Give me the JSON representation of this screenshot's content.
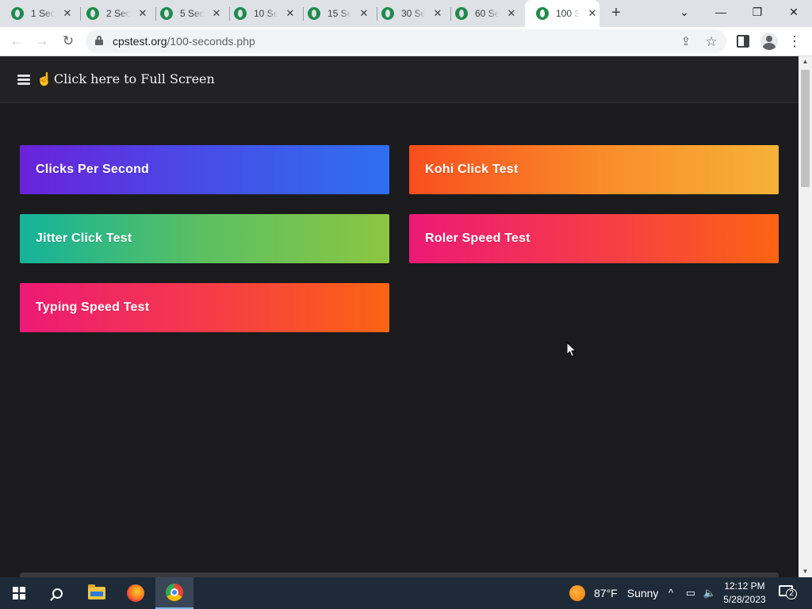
{
  "browser": {
    "tabs": [
      {
        "label": "1 Sec",
        "active": false
      },
      {
        "label": "2 Sec",
        "active": false
      },
      {
        "label": "5 Sec",
        "active": false
      },
      {
        "label": "10 Se",
        "active": false
      },
      {
        "label": "15 Se",
        "active": false
      },
      {
        "label": "30 Se",
        "active": false
      },
      {
        "label": "60 Se",
        "active": false
      },
      {
        "label": "100 S",
        "active": true
      }
    ],
    "tab_close_glyph": "✕",
    "new_tab_glyph": "+",
    "tab_search_glyph": "⌄",
    "window_controls": {
      "minimize": "—",
      "restore": "❐",
      "close": "✕"
    },
    "nav": {
      "back": "←",
      "forward": "→",
      "reload": "↻"
    },
    "address": {
      "host": "cpstest.org",
      "path": "/100-seconds.php"
    },
    "toolbar_icons": {
      "share": "⇪",
      "bookmark": "☆",
      "menu": "⋮"
    }
  },
  "page": {
    "fullscreen_link": "Click here to Full Screen",
    "hand_glyph": "☝",
    "cards": [
      {
        "label": "Clicks Per Second"
      },
      {
        "label": "Kohi Click Test"
      },
      {
        "label": "Jitter Click Test"
      },
      {
        "label": "Roler Speed Test"
      },
      {
        "label": "Typing Speed Test"
      }
    ],
    "colors": {
      "background": "#1b1b1d",
      "topbar": "#222224",
      "card_purple_blue": [
        "#6a22d8",
        "#2e6ff0"
      ],
      "card_orange_yellow": [
        "#f94f1e",
        "#f5b238"
      ],
      "card_teal_green": [
        "#14b39a",
        "#8cc642"
      ],
      "card_pink_orange": [
        "#ec1a76",
        "#fb6512"
      ]
    }
  },
  "scrollbar": {
    "up": "▲",
    "down": "▼"
  },
  "taskbar": {
    "weather": {
      "temp": "87°F",
      "condition": "Sunny"
    },
    "tray": {
      "chevron": "^",
      "network": "▭",
      "volume": "🔈"
    },
    "clock": {
      "time": "12:12 PM",
      "date": "5/28/2023"
    },
    "notification_count": "2"
  }
}
